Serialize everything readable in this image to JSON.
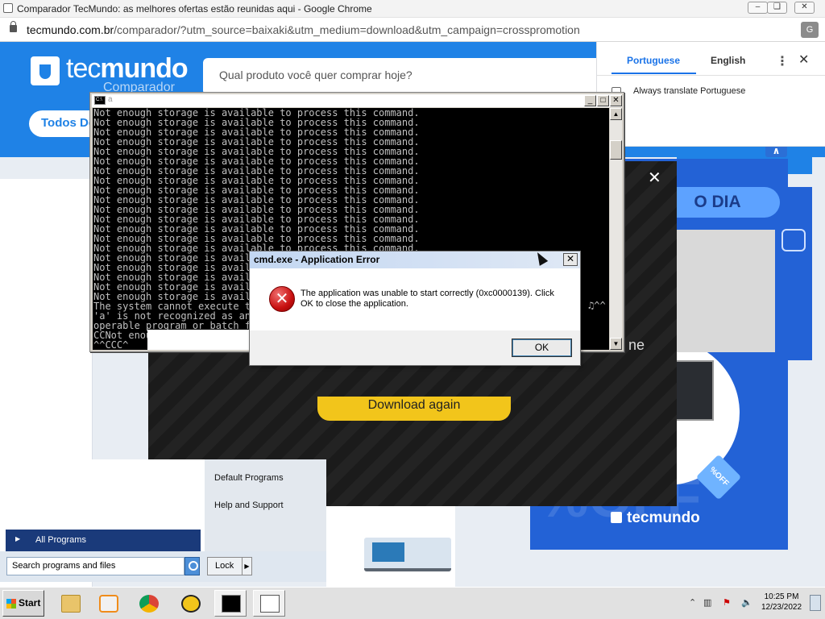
{
  "browser": {
    "window_title": "Comparador TecMundo: as melhores ofertas estão reunidas aqui - Google Chrome",
    "url_host": "tecmundo.com.br",
    "url_path": "/comparador/?utm_source=baixaki&utm_medium=download&utm_campaign=crosspromotion"
  },
  "site": {
    "logo_prefix": "tec",
    "logo_suffix": "mundo",
    "logo_sub": "Comparador",
    "search_placeholder": "Qual produto você quer comprar hoje?",
    "todos_button": "Todos De",
    "promo_badge": "O DIA",
    "promo_brand": "tecmundo",
    "promo_tag": "%OFF",
    "promo_bg_text": "%OFF",
    "modal_download": "Download again",
    "modal_side_text": "ne"
  },
  "translate": {
    "tab_active": "Portuguese",
    "tab_inactive": "English",
    "always_label": "Always translate Portuguese"
  },
  "cmd": {
    "title": "a",
    "lines": [
      "Not enough storage is available to process this command.",
      "Not enough storage is available to process this command.",
      "Not enough storage is available to process this command.",
      "Not enough storage is available to process this command.",
      "Not enough storage is available to process this command.",
      "Not enough storage is available to process this command.",
      "Not enough storage is available to process this command.",
      "Not enough storage is available to process this command.",
      "Not enough storage is available to process this command.",
      "Not enough storage is available to process this command.",
      "Not enough storage is available to process this command.",
      "Not enough storage is available to process this command.",
      "Not enough storage is available to process this command.",
      "Not enough storage is available to process this command.",
      "Not enough storage is available to process this command.",
      "Not enough storage is available to process this command.",
      "Not enough storage is available to process this command.",
      "Not enough storage is available to process this command.",
      "Not enough storage is available to process this command.",
      "Not enough storage is available to process this command.",
      "The system cannot execute the specified program.",
      "'a' is not recognized as an internal or external command,",
      "operable program or batch file.",
      "CCNot enough storage is available to process this command.",
      "^^CCC^"
    ],
    "glyph": "♫^^"
  },
  "error_dialog": {
    "title": "cmd.exe - Application Error",
    "message": "The application was unable to start correctly (0xc0000139). Click OK to close the application.",
    "ok_label": "OK"
  },
  "start_menu": {
    "right_items": [
      "Default Programs",
      "Help and Support"
    ],
    "all_programs": "All Programs",
    "search_placeholder": "Search programs and files",
    "lock_label": "Lock"
  },
  "taskbar": {
    "start_label": "Start",
    "time": "10:25 PM",
    "date": "12/23/2022"
  }
}
